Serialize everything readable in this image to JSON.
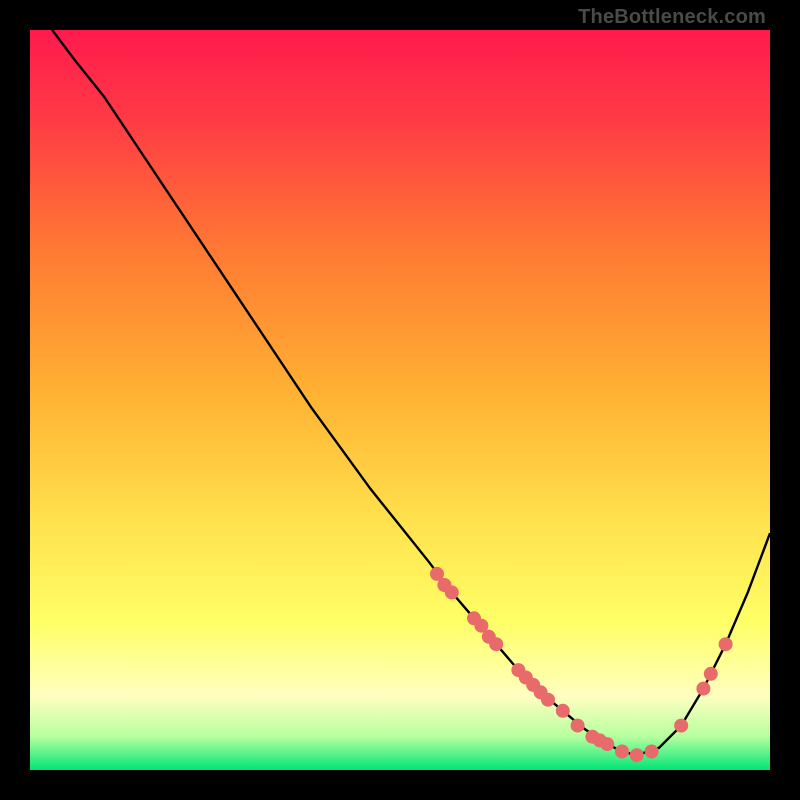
{
  "attribution": "TheBottleneck.com",
  "colors": {
    "frame": "#000000",
    "gradient_top": "#ff1a4d",
    "gradient_mid1": "#ff7a33",
    "gradient_mid2": "#ffd633",
    "gradient_mid3": "#ffff66",
    "gradient_bottom": "#00e676",
    "curve": "#000000",
    "dot_fill": "#e86a6a",
    "dot_stroke": "#c94f4f"
  },
  "chart_data": {
    "type": "line",
    "title": "",
    "xlabel": "",
    "ylabel": "",
    "xlim": [
      0,
      100
    ],
    "ylim": [
      0,
      100
    ],
    "series": [
      {
        "name": "curve",
        "x": [
          3,
          6,
          10,
          14,
          18,
          22,
          26,
          30,
          34,
          38,
          42,
          46,
          50,
          54,
          57,
          60,
          63,
          66,
          69,
          72,
          75,
          78,
          80,
          82,
          85,
          88,
          91,
          94,
          97,
          100
        ],
        "y": [
          100,
          96,
          91,
          85,
          79,
          73,
          67,
          61,
          55,
          49,
          43.5,
          38,
          33,
          28,
          24,
          20.5,
          17,
          13.5,
          10.5,
          8,
          5.5,
          3.5,
          2.5,
          2,
          3,
          6,
          11,
          17,
          24,
          32
        ]
      }
    ],
    "scatter_points": [
      {
        "x": 55,
        "y": 26.5
      },
      {
        "x": 56,
        "y": 25
      },
      {
        "x": 57,
        "y": 24
      },
      {
        "x": 60,
        "y": 20.5
      },
      {
        "x": 61,
        "y": 19.5
      },
      {
        "x": 62,
        "y": 18
      },
      {
        "x": 63,
        "y": 17
      },
      {
        "x": 66,
        "y": 13.5
      },
      {
        "x": 67,
        "y": 12.5
      },
      {
        "x": 68,
        "y": 11.5
      },
      {
        "x": 69,
        "y": 10.5
      },
      {
        "x": 70,
        "y": 9.5
      },
      {
        "x": 72,
        "y": 8
      },
      {
        "x": 74,
        "y": 6
      },
      {
        "x": 76,
        "y": 4.5
      },
      {
        "x": 77,
        "y": 4
      },
      {
        "x": 78,
        "y": 3.5
      },
      {
        "x": 80,
        "y": 2.5
      },
      {
        "x": 82,
        "y": 2
      },
      {
        "x": 84,
        "y": 2.5
      },
      {
        "x": 88,
        "y": 6
      },
      {
        "x": 91,
        "y": 11
      },
      {
        "x": 92,
        "y": 13
      },
      {
        "x": 94,
        "y": 17
      }
    ],
    "gradient_stops": [
      {
        "offset": 0.0,
        "color": "#ff1a4d"
      },
      {
        "offset": 0.12,
        "color": "#ff3a45"
      },
      {
        "offset": 0.3,
        "color": "#ff7a33"
      },
      {
        "offset": 0.5,
        "color": "#ffb433"
      },
      {
        "offset": 0.66,
        "color": "#ffe04d"
      },
      {
        "offset": 0.8,
        "color": "#ffff66"
      },
      {
        "offset": 0.9,
        "color": "#ffffc0"
      },
      {
        "offset": 0.955,
        "color": "#b6ff9e"
      },
      {
        "offset": 1.0,
        "color": "#00e676"
      }
    ]
  }
}
